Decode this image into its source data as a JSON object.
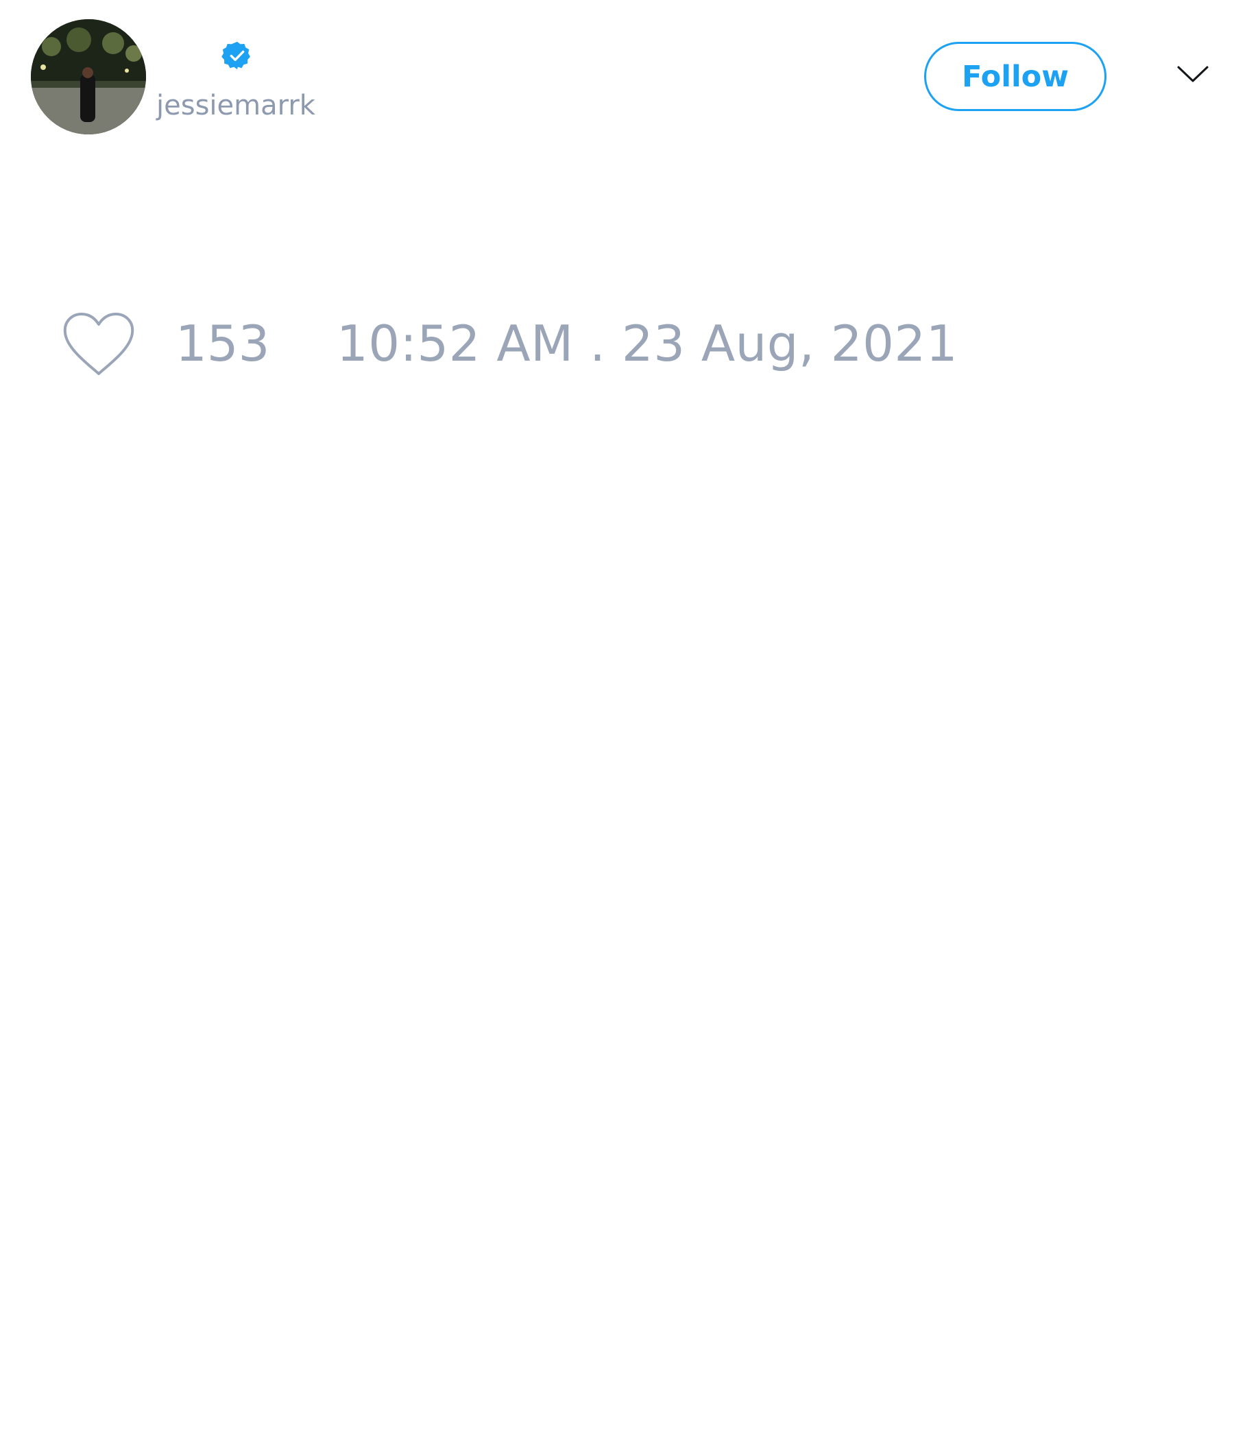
{
  "tweet": {
    "author": {
      "handle": "jessiemarrk",
      "verified": true,
      "avatar_icon": "profile-photo"
    },
    "follow_label": "Follow",
    "menu_icon": "chevron-down-icon",
    "likes": {
      "icon": "heart-icon",
      "count": "153"
    },
    "timestamp": "10:52 AM . 23 Aug, 2021"
  },
  "colors": {
    "accent": "#1da1f2",
    "muted_text": "#9aa5b8",
    "background": "#ffffff"
  }
}
